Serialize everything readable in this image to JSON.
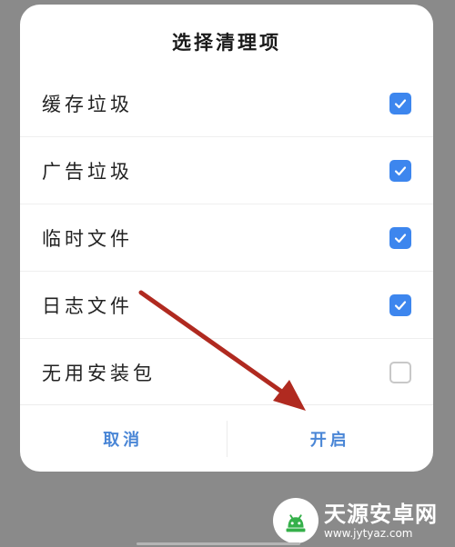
{
  "dialog": {
    "title": "选择清理项",
    "options": [
      {
        "label": "缓存垃圾",
        "checked": true
      },
      {
        "label": "广告垃圾",
        "checked": true
      },
      {
        "label": "临时文件",
        "checked": true
      },
      {
        "label": "日志文件",
        "checked": true
      },
      {
        "label": "无用安装包",
        "checked": false
      }
    ],
    "cancel_label": "取消",
    "confirm_label": "开启"
  },
  "watermark": {
    "name": "天源安卓网",
    "url": "www.jytyaz.com"
  },
  "colors": {
    "accent": "#3d86ee",
    "button_text": "#4a86d6",
    "annotation_arrow": "#b02a20",
    "backdrop": "#8a8a8a"
  }
}
